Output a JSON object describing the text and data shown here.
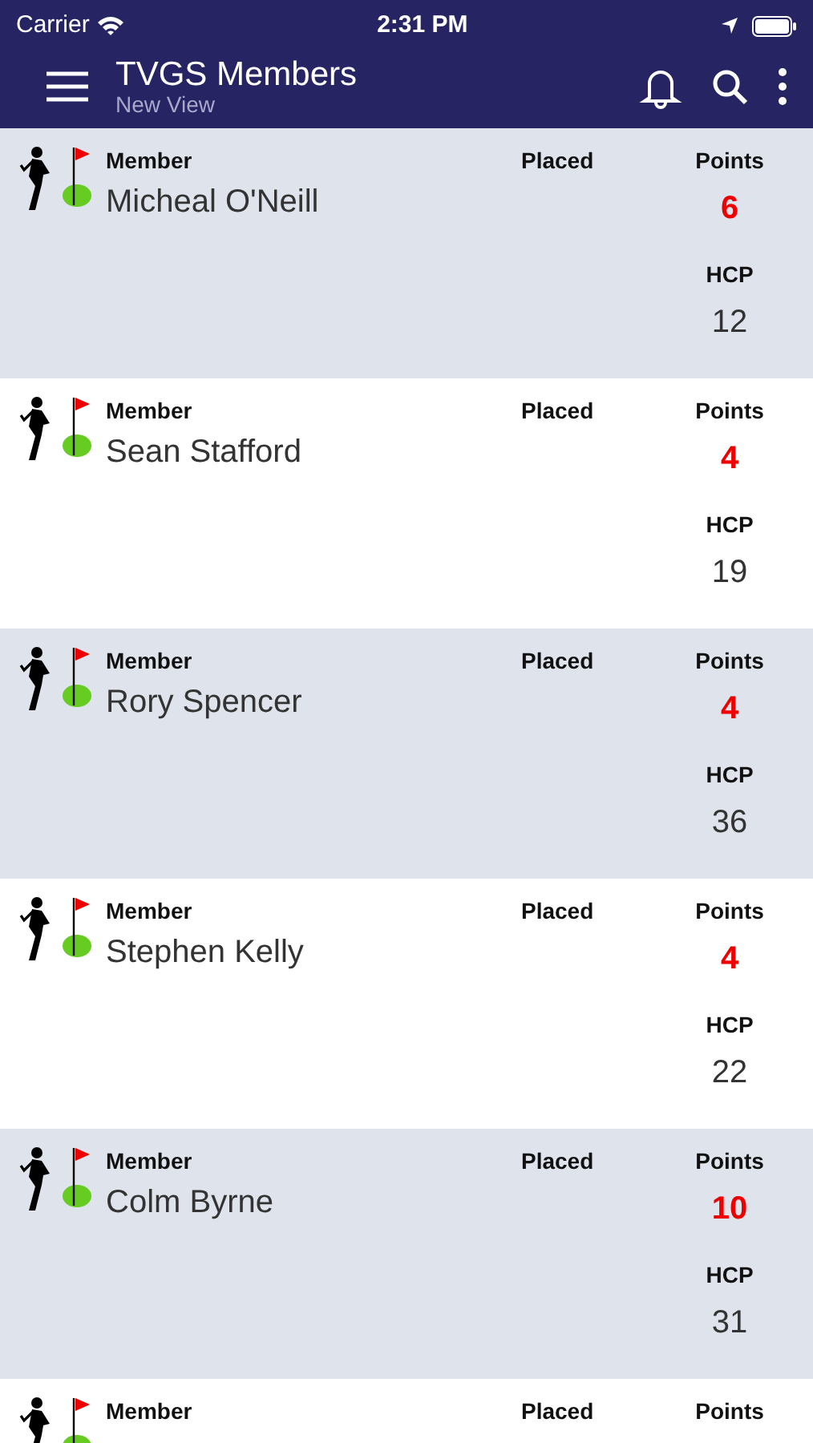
{
  "status_bar": {
    "carrier": "Carrier",
    "time": "2:31 PM"
  },
  "app_bar": {
    "title": "TVGS Members",
    "subtitle": "New View"
  },
  "members": [
    {
      "member_label": "Member",
      "name": "Micheal O'Neill",
      "placed_label": "Placed",
      "points_label": "Points",
      "points": "6",
      "hcp_label": "HCP",
      "hcp": "12"
    },
    {
      "member_label": "Member",
      "name": "Sean Stafford",
      "placed_label": "Placed",
      "points_label": "Points",
      "points": "4",
      "hcp_label": "HCP",
      "hcp": "19"
    },
    {
      "member_label": "Member",
      "name": "Rory Spencer",
      "placed_label": "Placed",
      "points_label": "Points",
      "points": "4",
      "hcp_label": "HCP",
      "hcp": "36"
    },
    {
      "member_label": "Member",
      "name": "Stephen Kelly",
      "placed_label": "Placed",
      "points_label": "Points",
      "points": "4",
      "hcp_label": "HCP",
      "hcp": "22"
    },
    {
      "member_label": "Member",
      "name": "Colm Byrne",
      "placed_label": "Placed",
      "points_label": "Points",
      "points": "10",
      "hcp_label": "HCP",
      "hcp": "31"
    },
    {
      "member_label": "Member",
      "placed_label": "Placed",
      "points_label": "Points"
    }
  ]
}
